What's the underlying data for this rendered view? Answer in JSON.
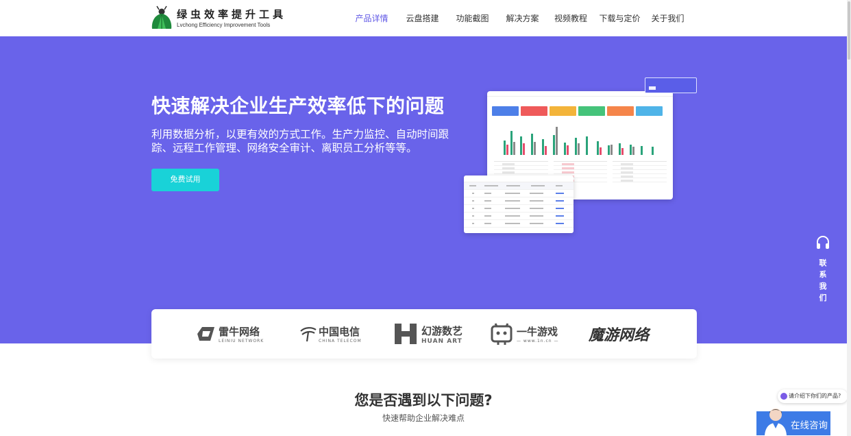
{
  "brand": {
    "name_cn": "绿虫效率提升工具",
    "name_en": "Lvchong Efficiency Improvement Tools"
  },
  "nav": [
    {
      "label": "产品详情",
      "active": true
    },
    {
      "label": "云盘搭建",
      "active": false
    },
    {
      "label": "功能截图",
      "active": false
    },
    {
      "label": "解决方案",
      "active": false
    },
    {
      "label": "视频教程",
      "active": false
    },
    {
      "label": "下载与定价",
      "active": false
    },
    {
      "label": "关于我们",
      "active": false
    }
  ],
  "hero": {
    "title": "快速解决企业生产效率低下的问题",
    "subtitle": "利用数据分析，以更有效的方式工作。生产力监控、自动时间跟踪、远程工作管理、网络安全审计、离职员工分析等等。",
    "cta_label": "免费试用"
  },
  "partners": [
    {
      "name": "雷牛网络",
      "sub": "LEINIU NETWORK"
    },
    {
      "name": "中国电信",
      "sub": "CHINA TELECOM"
    },
    {
      "name": "幻游数艺",
      "sub": "HUAN ART"
    },
    {
      "name": "一牛游戏",
      "sub": "— www.1n.cn —"
    },
    {
      "name": "魔游网络",
      "sub": ""
    }
  ],
  "problems": {
    "title": "您是否遇到以下问题?",
    "subtitle": "快速帮助企业解决难点"
  },
  "contact": {
    "label_chars": [
      "联",
      "系",
      "我",
      "们"
    ]
  },
  "chat": {
    "bubble": "请介绍下你们的产品?",
    "consult_label": "在线咨询"
  },
  "colors": {
    "hero_bg": "#6963ea",
    "accent": "#6159e6",
    "cta": "#19d2d8",
    "consult": "#3d7be6"
  }
}
